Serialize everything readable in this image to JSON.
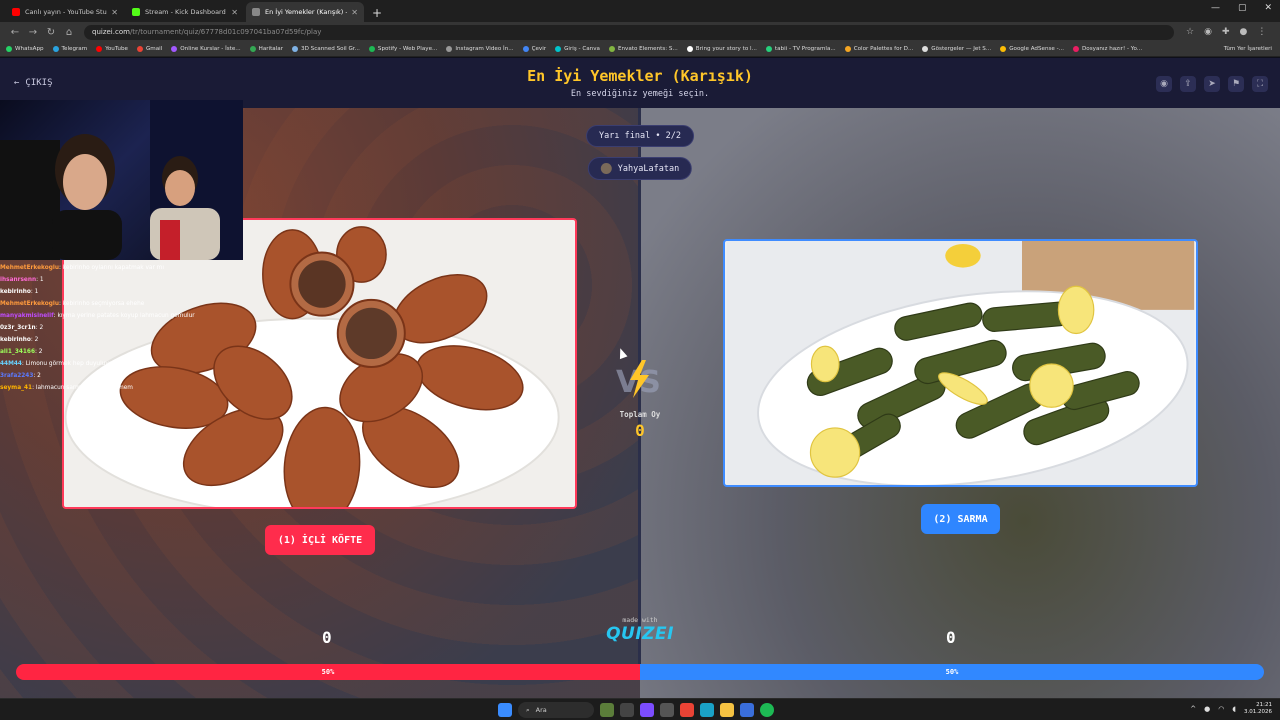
{
  "browser": {
    "tabs": [
      {
        "title": "Canlı yayın - YouTube Studio",
        "color": "#ff0000",
        "active": false
      },
      {
        "title": "Stream - Kick Dashboard",
        "color": "#53fc18",
        "active": false
      },
      {
        "title": "En İyi Yemekler (Karışık) - Tier l",
        "color": "#888888",
        "active": true
      }
    ],
    "url_host": "quizei.com",
    "url_path": "/tr/tournament/quiz/67778d01c097041ba07d59fc/play",
    "bookmarks": [
      {
        "label": "WhatsApp",
        "color": "#25d366"
      },
      {
        "label": "Telegram",
        "color": "#2aa3df"
      },
      {
        "label": "YouTube",
        "color": "#ff0000"
      },
      {
        "label": "Gmail",
        "color": "#ea4335"
      },
      {
        "label": "Online Kurslar - İste...",
        "color": "#a259ff"
      },
      {
        "label": "Haritalar",
        "color": "#34a853"
      },
      {
        "label": "3D Scanned Soil Gr...",
        "color": "#7fb2e5"
      },
      {
        "label": "Spotify - Web Playe...",
        "color": "#1db954"
      },
      {
        "label": "Instagram Video İn...",
        "color": "#999999"
      },
      {
        "label": "Çevir",
        "color": "#4285f4"
      },
      {
        "label": "Giriş - Canva",
        "color": "#00c4cc"
      },
      {
        "label": "Envato Elements: S...",
        "color": "#82b541"
      },
      {
        "label": "Bring your story to l...",
        "color": "#ffffff"
      },
      {
        "label": "tabii - TV Programla...",
        "color": "#26d07c"
      },
      {
        "label": "Color Palettes for D...",
        "color": "#f5a623"
      },
      {
        "label": "Göstergeler — Jet S...",
        "color": "#dddddd"
      },
      {
        "label": "Google AdSense -...",
        "color": "#fbbc05"
      },
      {
        "label": "Dosyanız hazır! - Yo...",
        "color": "#e91e63"
      }
    ],
    "bookmarks_right": "Tüm Yer İşaretleri"
  },
  "header": {
    "back_label": "ÇIKIŞ",
    "title": "En İyi Yemekler (Karışık)",
    "subtitle": "En sevdiğiniz yemeği seçin."
  },
  "round": {
    "stage": "Yarı final • 2/2",
    "username": "YahyaLafatan"
  },
  "options": {
    "left": {
      "label": "(1) İÇLİ KÖFTE",
      "votes": "0",
      "percent": 50,
      "percent_label": "50%"
    },
    "right": {
      "label": "(2) SARMA",
      "votes": "0",
      "percent": 50,
      "percent_label": "50%"
    }
  },
  "total": {
    "label": "Toplam Oy",
    "value": "0"
  },
  "branding": {
    "made_with": "made with",
    "logo": "QUIZEI"
  },
  "chat": [
    {
      "user": "MehmetErkekoglu",
      "user_color": "#ff9b3d",
      "msg": ": kebirinho oylarını kapatmak var mı"
    },
    {
      "user": "ihsanrsenn",
      "user_color": "#ff6ad5",
      "msg": ": 1"
    },
    {
      "user": "kebirinho",
      "user_color": "#ffffff",
      "msg": ": 1"
    },
    {
      "user": "MehmetErkekoglu",
      "user_color": "#ff9b3d",
      "msg": ": kebirinho seçmiyorsa ehehe"
    },
    {
      "user": "manyakmisinelif",
      "user_color": "#c04cff",
      "msg": ": kıyma yerine patates koyup lahmacun gomulur"
    },
    {
      "user": "0z3r_3cr1n",
      "user_color": "#ffffff",
      "msg": ": 2"
    },
    {
      "user": "kebirinho",
      "user_color": "#ffffff",
      "msg": ": 2"
    },
    {
      "user": "ali1_34166",
      "user_color": "#9cff5a",
      "msg": ": 2"
    },
    {
      "user": "44M44",
      "user_color": "#67d3ff",
      "msg": ": Limonu görmek hep duyuluyo"
    },
    {
      "user": "3rafa2243",
      "user_color": "#5a7aff",
      "msg": ": 2"
    },
    {
      "user": "seyma_41",
      "user_color": "#ffb400",
      "msg": ": lahmacun sarma yemek istemem"
    }
  ],
  "taskbar": {
    "search": "Ara",
    "time": "21:21",
    "date": "3.01.2026"
  },
  "colors": {
    "accent_yellow": "#ffc629",
    "left_red": "#ff2542",
    "right_blue": "#3188ff",
    "header_bg": "#1a1b36"
  }
}
